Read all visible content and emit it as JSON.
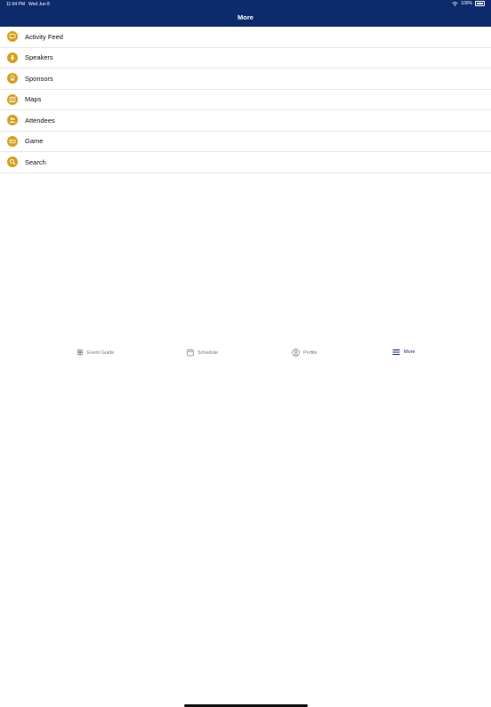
{
  "status": {
    "time": "11:04 PM",
    "date": "Wed Jun 8",
    "battery": "100%"
  },
  "header": {
    "title": "More"
  },
  "menu": {
    "items": [
      {
        "label": "Activity Feed",
        "icon": "chat-bubble-icon"
      },
      {
        "label": "Speakers",
        "icon": "microphone-icon"
      },
      {
        "label": "Sponsors",
        "icon": "badge-icon"
      },
      {
        "label": "Maps",
        "icon": "map-icon"
      },
      {
        "label": "Attendees",
        "icon": "people-icon"
      },
      {
        "label": "Game",
        "icon": "gamepad-icon"
      },
      {
        "label": "Search",
        "icon": "search-icon"
      }
    ]
  },
  "tabs": [
    {
      "label": "Event Guide",
      "icon": "signpost-icon"
    },
    {
      "label": "Schedule",
      "icon": "calendar-icon"
    },
    {
      "label": "Profile",
      "icon": "profile-icon"
    },
    {
      "label": "More",
      "icon": "menu-icon",
      "active": true
    }
  ],
  "colors": {
    "header_bg": "#0d2a6b",
    "icon_bg": "#d59f1f",
    "active_tab": "#0d2a6b"
  }
}
